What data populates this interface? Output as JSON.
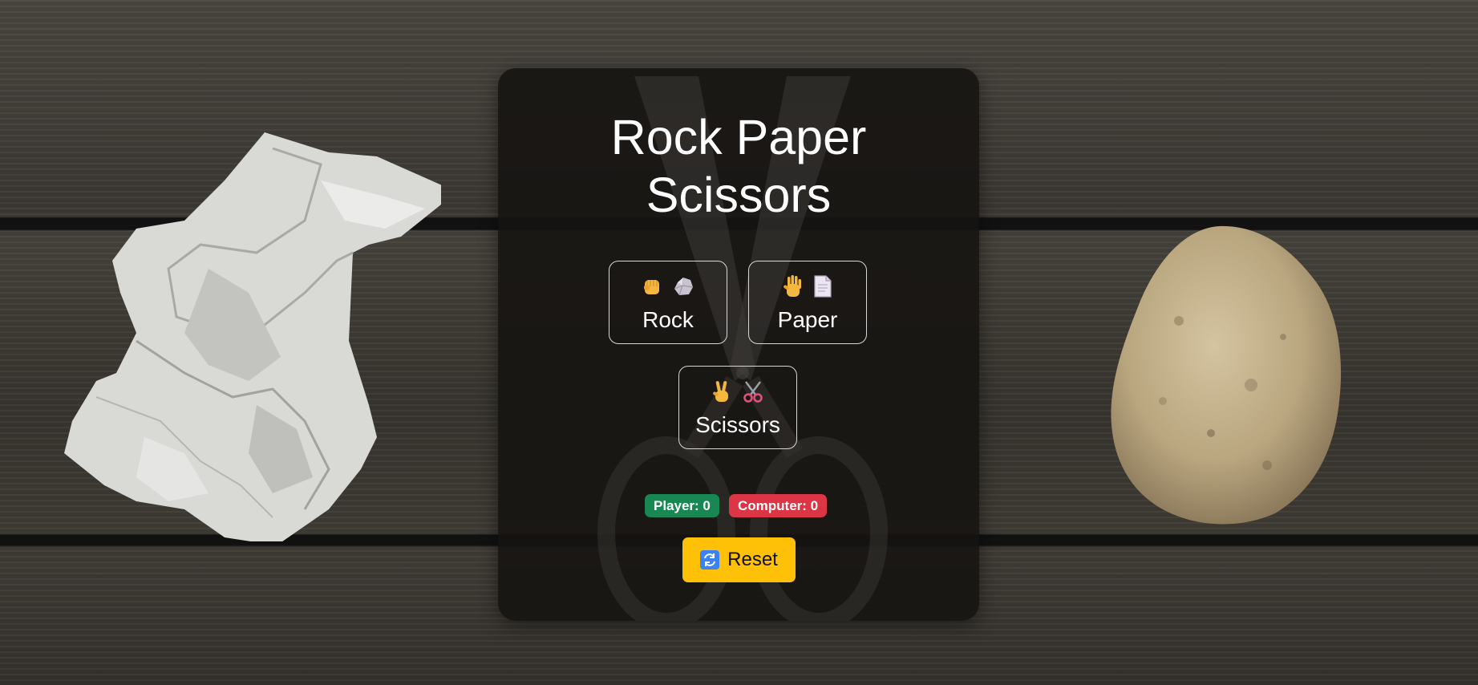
{
  "game": {
    "title_line1": "Rock Paper",
    "title_line2": "Scissors"
  },
  "choices": [
    {
      "label": "Rock",
      "icons": [
        "raised-fist-icon",
        "rock-icon"
      ]
    },
    {
      "label": "Paper",
      "icons": [
        "raised-hand-icon",
        "page-icon"
      ]
    },
    {
      "label": "Scissors",
      "icons": [
        "victory-hand-icon",
        "scissors-icon"
      ]
    }
  ],
  "score": {
    "player": "Player: 0",
    "computer": "Computer: 0",
    "player_color": "#198754",
    "computer_color": "#dc3545"
  },
  "reset": {
    "label": "Reset",
    "icon": "refresh-icon",
    "color": "#ffc107"
  }
}
